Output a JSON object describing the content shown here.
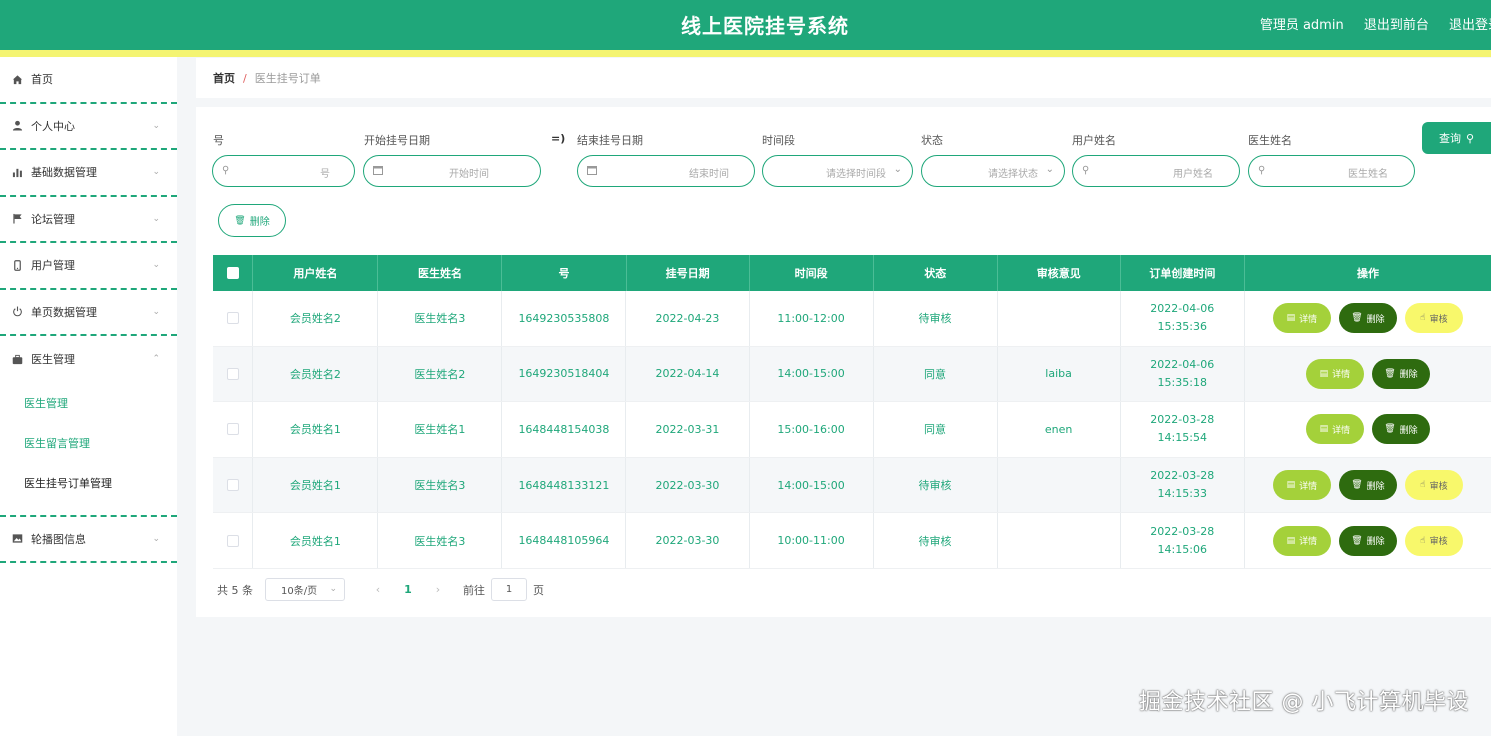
{
  "header": {
    "title": "线上医院挂号系统",
    "admin": "管理员 admin",
    "to_front": "退出到前台",
    "logout": "退出登录"
  },
  "sidebar": {
    "items": [
      {
        "label": "首页",
        "icon": "home-icon"
      },
      {
        "label": "个人中心",
        "icon": "user-icon"
      },
      {
        "label": "基础数据管理",
        "icon": "bar-chart-icon"
      },
      {
        "label": "论坛管理",
        "icon": "flag-icon"
      },
      {
        "label": "用户管理",
        "icon": "phone-icon"
      },
      {
        "label": "单页数据管理",
        "icon": "power-icon"
      },
      {
        "label": "医生管理",
        "icon": "briefcase-icon"
      },
      {
        "label": "轮播图信息",
        "icon": "image-icon"
      }
    ],
    "sub_items": [
      "医生管理",
      "医生留言管理",
      "医生挂号订单管理"
    ]
  },
  "breadcrumb": {
    "home": "首页",
    "sep": "/",
    "current": "医生挂号订单"
  },
  "filters": {
    "no_label": "号",
    "no_placeholder": "号",
    "start_label": "开始挂号日期",
    "start_placeholder": "开始时间",
    "range_sep": "=)",
    "end_label": "结束挂号日期",
    "end_placeholder": "结束时间",
    "period_label": "时间段",
    "period_placeholder": "请选择时间段",
    "status_label": "状态",
    "status_placeholder": "请选择状态",
    "user_label": "用户姓名",
    "user_placeholder": "用户姓名",
    "doctor_label": "医生姓名",
    "doctor_placeholder": "医生姓名",
    "search_label": "查询",
    "delete_label": "删除"
  },
  "table": {
    "columns": [
      "用户姓名",
      "医生姓名",
      "号",
      "挂号日期",
      "时间段",
      "状态",
      "审核意见",
      "订单创建时间",
      "操作"
    ],
    "rows": [
      {
        "user": "会员姓名2",
        "doctor": "医生姓名3",
        "no": "1649230535808",
        "date": "2022-04-23",
        "period": "11:00-12:00",
        "status": "待审核",
        "opinion": "",
        "created": "2022-04-06 15:35:36"
      },
      {
        "user": "会员姓名2",
        "doctor": "医生姓名2",
        "no": "1649230518404",
        "date": "2022-04-14",
        "period": "14:00-15:00",
        "status": "同意",
        "opinion": "laiba",
        "created": "2022-04-06 15:35:18"
      },
      {
        "user": "会员姓名1",
        "doctor": "医生姓名1",
        "no": "1648448154038",
        "date": "2022-03-31",
        "period": "15:00-16:00",
        "status": "同意",
        "opinion": "enen",
        "created": "2022-03-28 14:15:54"
      },
      {
        "user": "会员姓名1",
        "doctor": "医生姓名3",
        "no": "1648448133121",
        "date": "2022-03-30",
        "period": "14:00-15:00",
        "status": "待审核",
        "opinion": "",
        "created": "2022-03-28 14:15:33"
      },
      {
        "user": "会员姓名1",
        "doctor": "医生姓名3",
        "no": "1648448105964",
        "date": "2022-03-30",
        "period": "10:00-11:00",
        "status": "待审核",
        "opinion": "",
        "created": "2022-03-28 14:15:06"
      }
    ],
    "actions": {
      "detail": "详情",
      "delete": "删除",
      "audit": "审核"
    }
  },
  "pager": {
    "total": "共 5 条",
    "size": "10条/页",
    "current": "1",
    "goto": "前往",
    "goto_value": "1",
    "page": "页"
  },
  "watermark": "掘金技术社区 @ 小飞计算机毕设",
  "colors": {
    "primary": "#1fa77a",
    "stripe": "#f4f472",
    "detail": "#a4d13a",
    "delete": "#2e6b0f",
    "audit": "#f8f86b"
  }
}
